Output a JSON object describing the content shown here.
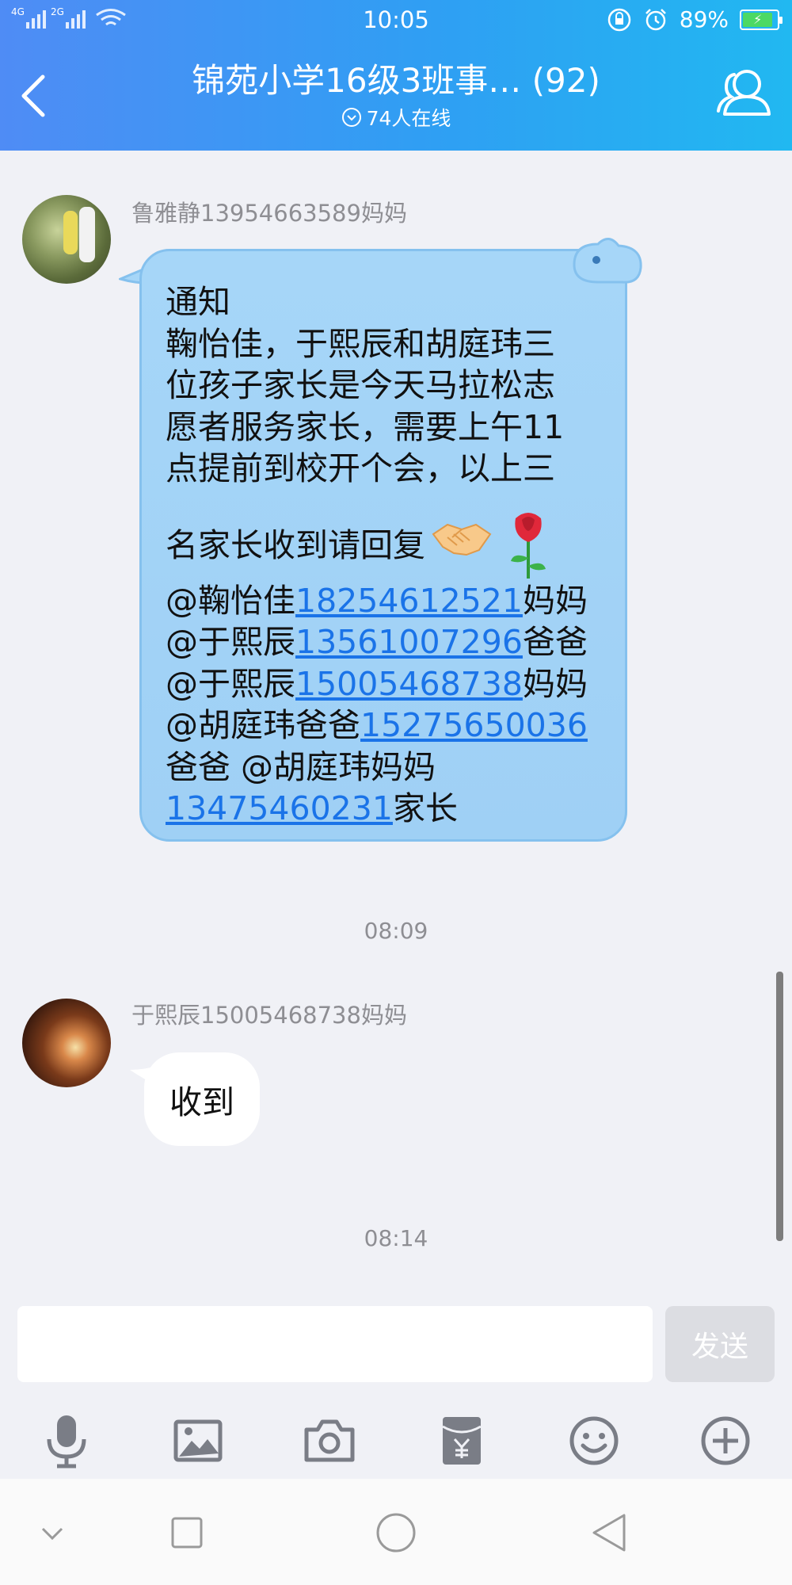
{
  "status_bar": {
    "network_1": "4G",
    "network_2": "2G",
    "time": "10:05",
    "battery": "89%"
  },
  "header": {
    "title": "锦苑小学16级3班事… (92)",
    "online": "74人在线"
  },
  "messages": [
    {
      "sender": "鲁雅静13954663589妈妈",
      "lines": {
        "l1": "通知",
        "l2": "鞠怡佳，于熙辰和胡庭玮三",
        "l3": "位孩子家长是今天马拉松志",
        "l4": "愿者服务家长，需要上午11",
        "l5": "点提前到校开个会，以上三",
        "l6": "名家长收到请回复",
        "l7_a": "@鞠怡佳",
        "l7_phone": "18254612521",
        "l7_b": "妈妈",
        "l8_a": "@于熙辰",
        "l8_phone": "13561007296",
        "l8_b": "爸爸",
        "l9_a": "@于熙辰",
        "l9_phone": "15005468738",
        "l9_b": "妈妈",
        "l10_a": "@胡庭玮爸爸",
        "l10_phone": "15275650036",
        "l11": "爸爸 @胡庭玮妈妈",
        "l12_phone": "13475460231",
        "l12_b": "家长"
      }
    },
    {
      "sender": "于熙辰15005468738妈妈",
      "text": "收到"
    }
  ],
  "timestamps": [
    "08:09",
    "08:14"
  ],
  "input": {
    "value": "",
    "send_label": "发送"
  },
  "toolbar_icons": [
    "microphone-icon",
    "image-icon",
    "camera-icon",
    "red-packet-icon",
    "emoji-icon",
    "plus-icon"
  ],
  "nav_icons": [
    "chevron-down-icon",
    "square-icon",
    "circle-icon",
    "triangle-back-icon"
  ],
  "colors": {
    "header_start": "#4f8cf5",
    "header_end": "#21b8f1",
    "bubble_blue": "#a6d6f8",
    "link": "#1a73e8",
    "background": "#f0f1f6"
  }
}
